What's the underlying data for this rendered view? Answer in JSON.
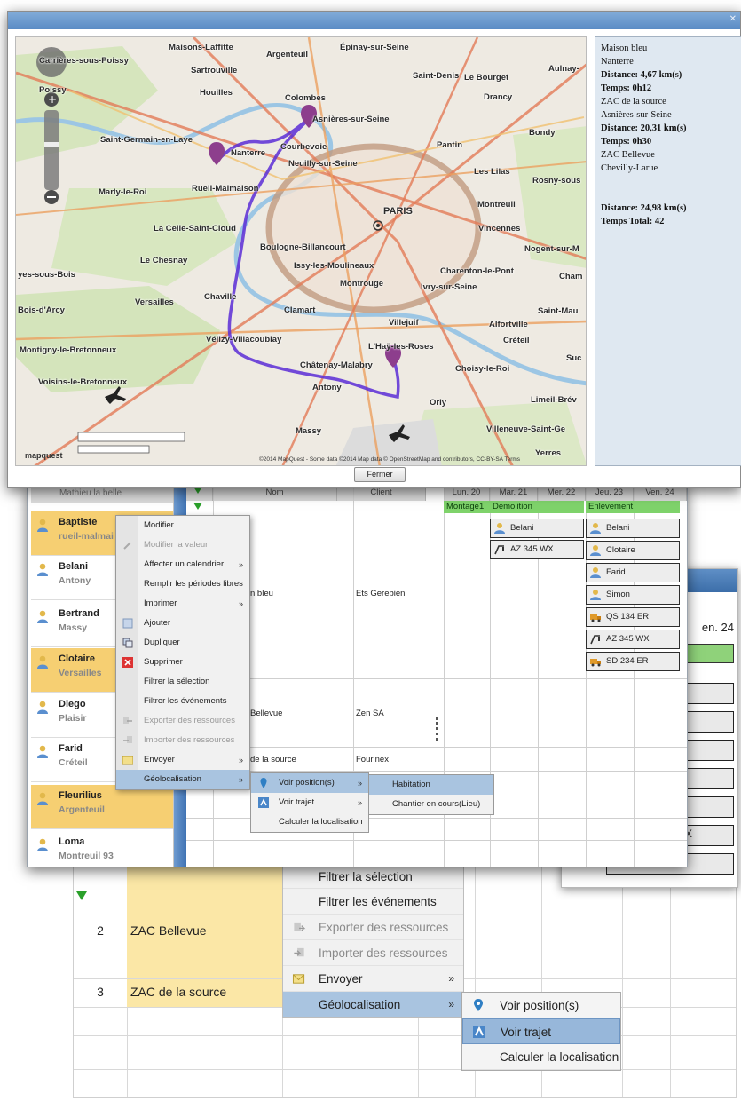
{
  "map_window": {
    "close_button": "Fermer",
    "info": {
      "lines": [
        {
          "text": "Maison bleu",
          "bold": false
        },
        {
          "text": "Nanterre",
          "bold": false
        },
        {
          "text": "Distance: 4,67 km(s)",
          "bold": true
        },
        {
          "text": "Temps: 0h12",
          "bold": true
        },
        {
          "text": "ZAC de la source",
          "bold": false
        },
        {
          "text": "Asnières-sur-Seine",
          "bold": false
        },
        {
          "text": "Distance: 20,31 km(s)",
          "bold": true
        },
        {
          "text": "Temps: 0h30",
          "bold": true
        },
        {
          "text": "ZAC Bellevue",
          "bold": false
        },
        {
          "text": "Chevilly-Larue",
          "bold": false
        }
      ],
      "total_distance": "Distance: 24,98 km(s)",
      "total_time": "Temps Total: 42"
    },
    "map": {
      "places": [
        {
          "name": "Maisons-Laffitte"
        },
        {
          "name": "Épinay-sur-Seine"
        },
        {
          "name": "Argenteuil"
        },
        {
          "name": "Carrières-sous-Poissy"
        },
        {
          "name": "Sartrouville"
        },
        {
          "name": "Saint-Denis"
        },
        {
          "name": "Le Bourget"
        },
        {
          "name": "Aulnay-"
        },
        {
          "name": "Poissy"
        },
        {
          "name": "Houilles"
        },
        {
          "name": "Colombes"
        },
        {
          "name": "Drancy"
        },
        {
          "name": "Asnières-sur-Seine"
        },
        {
          "name": "Bondy"
        },
        {
          "name": "Saint-Germain-en-Laye"
        },
        {
          "name": "Courbevoie"
        },
        {
          "name": "Pantin"
        },
        {
          "name": "Nanterre"
        },
        {
          "name": "Neuilly-sur-Seine"
        },
        {
          "name": "Les Lilas"
        },
        {
          "name": "Rosny-sous"
        },
        {
          "name": "Marly-le-Roi"
        },
        {
          "name": "Rueil-Malmaison"
        },
        {
          "name": "Montreuil"
        },
        {
          "name": "PARIS"
        },
        {
          "name": "La Celle-Saint-Cloud"
        },
        {
          "name": "Vincennes"
        },
        {
          "name": "Boulogne-Billancourt"
        },
        {
          "name": "Nogent-sur-M"
        },
        {
          "name": "Le Chesnay"
        },
        {
          "name": "Issy-les-Moulineaux"
        },
        {
          "name": "Charenton-le-Pont"
        },
        {
          "name": "yes-sous-Bois"
        },
        {
          "name": "Montrouge"
        },
        {
          "name": "Ivry-sur-Seine"
        },
        {
          "name": "Cham"
        },
        {
          "name": "Versailles"
        },
        {
          "name": "Chaville"
        },
        {
          "name": "Bois-d'Arcy"
        },
        {
          "name": "Clamart"
        },
        {
          "name": "Saint-Mau"
        },
        {
          "name": "Villejuif"
        },
        {
          "name": "Alfortville"
        },
        {
          "name": "Vélizy-Villacoublay"
        },
        {
          "name": "Créteil"
        },
        {
          "name": "Montigny-le-Bretonneux"
        },
        {
          "name": "L'Haÿ-les-Roses"
        },
        {
          "name": "Suc"
        },
        {
          "name": "Châtenay-Malabry"
        },
        {
          "name": "Choisy-le-Roi"
        },
        {
          "name": "Voisins-le-Bretonneux"
        },
        {
          "name": "Antony"
        },
        {
          "name": "Limeil-Brév"
        },
        {
          "name": "Orly"
        },
        {
          "name": "Massy"
        },
        {
          "name": "Villeneuve-Saint-Ge"
        },
        {
          "name": "Yerres"
        }
      ],
      "logo": "mapquest",
      "attribution": "©2014 MapQuest - Some data ©2014 Map data © OpenStreetMap and contributors, CC-BY-SA Terms"
    }
  },
  "planner": {
    "resources_header": "Mathieu la belle",
    "resources": [
      {
        "name": "Baptiste",
        "city": "rueil-malmai"
      },
      {
        "name": "Belani",
        "city": "Antony"
      },
      {
        "name": "Bertrand",
        "city": "Massy"
      },
      {
        "name": "Clotaire",
        "city": "Versailles"
      },
      {
        "name": "Diego",
        "city": "Plaisir"
      },
      {
        "name": "Farid",
        "city": "Créteil"
      },
      {
        "name": "Fleurilius",
        "city": "Argenteuil"
      },
      {
        "name": "Loma",
        "city": "Montreuil 93"
      }
    ],
    "columns": [
      "Nom",
      "Client",
      "Lun. 20",
      "Mar. 21",
      "Mer. 22",
      "Jeu. 23",
      "Ven. 24"
    ],
    "rows": [
      {
        "name": "n bleu",
        "client": "Ets Gerebien"
      },
      {
        "name": "Bellevue",
        "client": "Zen SA"
      },
      {
        "name": "de la source",
        "client": "Fourinex"
      }
    ],
    "events": {
      "montage": "Montage1",
      "demolition": "Démolition",
      "enlevement": "Enlèvement",
      "demolition_items": [
        "Belani",
        "AZ 345 WX"
      ],
      "enlevement_items": [
        "Belani",
        "Clotaire",
        "Farid",
        "Simon",
        "QS 134 ER",
        "AZ 345 WX",
        "SD 234 ER"
      ]
    },
    "context_menu": [
      {
        "label": "Modifier",
        "disabled": false,
        "arrow": false
      },
      {
        "label": "Modifier la valeur",
        "disabled": true,
        "arrow": false
      },
      {
        "label": "Affecter un calendrier",
        "disabled": false,
        "arrow": true
      },
      {
        "label": "Remplir les périodes libres",
        "disabled": false,
        "arrow": false
      },
      {
        "label": "Imprimer",
        "disabled": false,
        "arrow": true
      },
      {
        "label": "Ajouter",
        "disabled": false,
        "arrow": false
      },
      {
        "label": "Dupliquer",
        "disabled": false,
        "arrow": false
      },
      {
        "label": "Supprimer",
        "disabled": false,
        "arrow": false
      },
      {
        "label": "Filtrer la sélection",
        "disabled": false,
        "arrow": false
      },
      {
        "label": "Filtrer les événements",
        "disabled": false,
        "arrow": false
      },
      {
        "label": "Exporter des ressources",
        "disabled": true,
        "arrow": false
      },
      {
        "label": "Importer des ressources",
        "disabled": true,
        "arrow": false
      },
      {
        "label": "Envoyer",
        "disabled": false,
        "arrow": true
      },
      {
        "label": "Géolocalisation",
        "disabled": false,
        "arrow": true
      }
    ],
    "submenu_geo": [
      "Voir position(s)",
      "Voir trajet",
      "Calculer la localisation"
    ],
    "submenu_position": [
      "Habitation",
      "Chantier en cours(Lieu)"
    ],
    "arrow_glyph": "»"
  },
  "back_window": {
    "header": "en. 24",
    "partial": "X"
  },
  "bottom_layer": {
    "rows": [
      {
        "num": "2",
        "label": "ZAC Bellevue"
      },
      {
        "num": "3",
        "label": "ZAC de la source"
      }
    ],
    "menu": [
      {
        "label": "Filtrer la sélection",
        "disabled": false,
        "arrow": false
      },
      {
        "label": "Filtrer les événements",
        "disabled": false,
        "arrow": false
      },
      {
        "label": "Exporter des ressources",
        "disabled": true,
        "arrow": false
      },
      {
        "label": "Importer des ressources",
        "disabled": true,
        "arrow": false
      },
      {
        "label": "Envoyer",
        "disabled": false,
        "arrow": true
      },
      {
        "label": "Géolocalisation",
        "disabled": false,
        "arrow": true
      }
    ],
    "submenu": [
      "Voir position(s)",
      "Voir trajet",
      "Calculer la localisation"
    ],
    "arrow_glyph": "»"
  }
}
